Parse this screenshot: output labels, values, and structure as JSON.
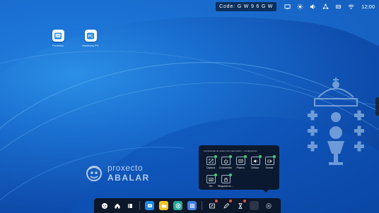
{
  "status_bar": {
    "code_label": "Code:",
    "code_value": "G W 9 6 G W",
    "icons": [
      "screen-share-icon",
      "brightness-icon",
      "volume-icon",
      "network-icon",
      "usb-icon",
      "wifi-icon"
    ],
    "clock": "12:00"
  },
  "desktop_icons": [
    {
      "label": "Proxecto",
      "icon": "presentation-icon"
    },
    {
      "label": "Escritorio PC",
      "icon": "pc-icon"
    }
  ],
  "logo": {
    "line1": "proxecto",
    "line2": "ABALAR"
  },
  "tools_panel": {
    "header": "Ferramentas de xestión dun panel táctil — Configuración",
    "tools": [
      {
        "label": "Captura",
        "icon": "screenshot-icon"
      },
      {
        "label": "Cronómetro",
        "icon": "power-icon"
      },
      {
        "label": "Pizarra",
        "icon": "whiteboard-icon"
      },
      {
        "label": "Difusor",
        "icon": "broadcast-icon"
      },
      {
        "label": "Gravar",
        "icon": "record-icon"
      },
      {
        "label": "Ver",
        "icon": "image-icon"
      },
      {
        "label": "Bloquear ec...",
        "icon": "lock-icon"
      }
    ]
  },
  "taskbar": {
    "left": [
      "back-icon",
      "home-icon",
      "windows-icon"
    ],
    "apps": [
      "presentation-app-icon",
      "folder-app-icon",
      "browser-app-icon",
      "apps-grid-icon"
    ],
    "right": [
      "annotate-icon",
      "pen-icon",
      "timer-icon",
      "blank-app-icon",
      "tools-toggle-icon"
    ]
  },
  "colors": {
    "accent": "#1a6fd0",
    "panel": "#0c1626",
    "green_dot": "#3ad07a",
    "red_badge": "#e8563f"
  }
}
